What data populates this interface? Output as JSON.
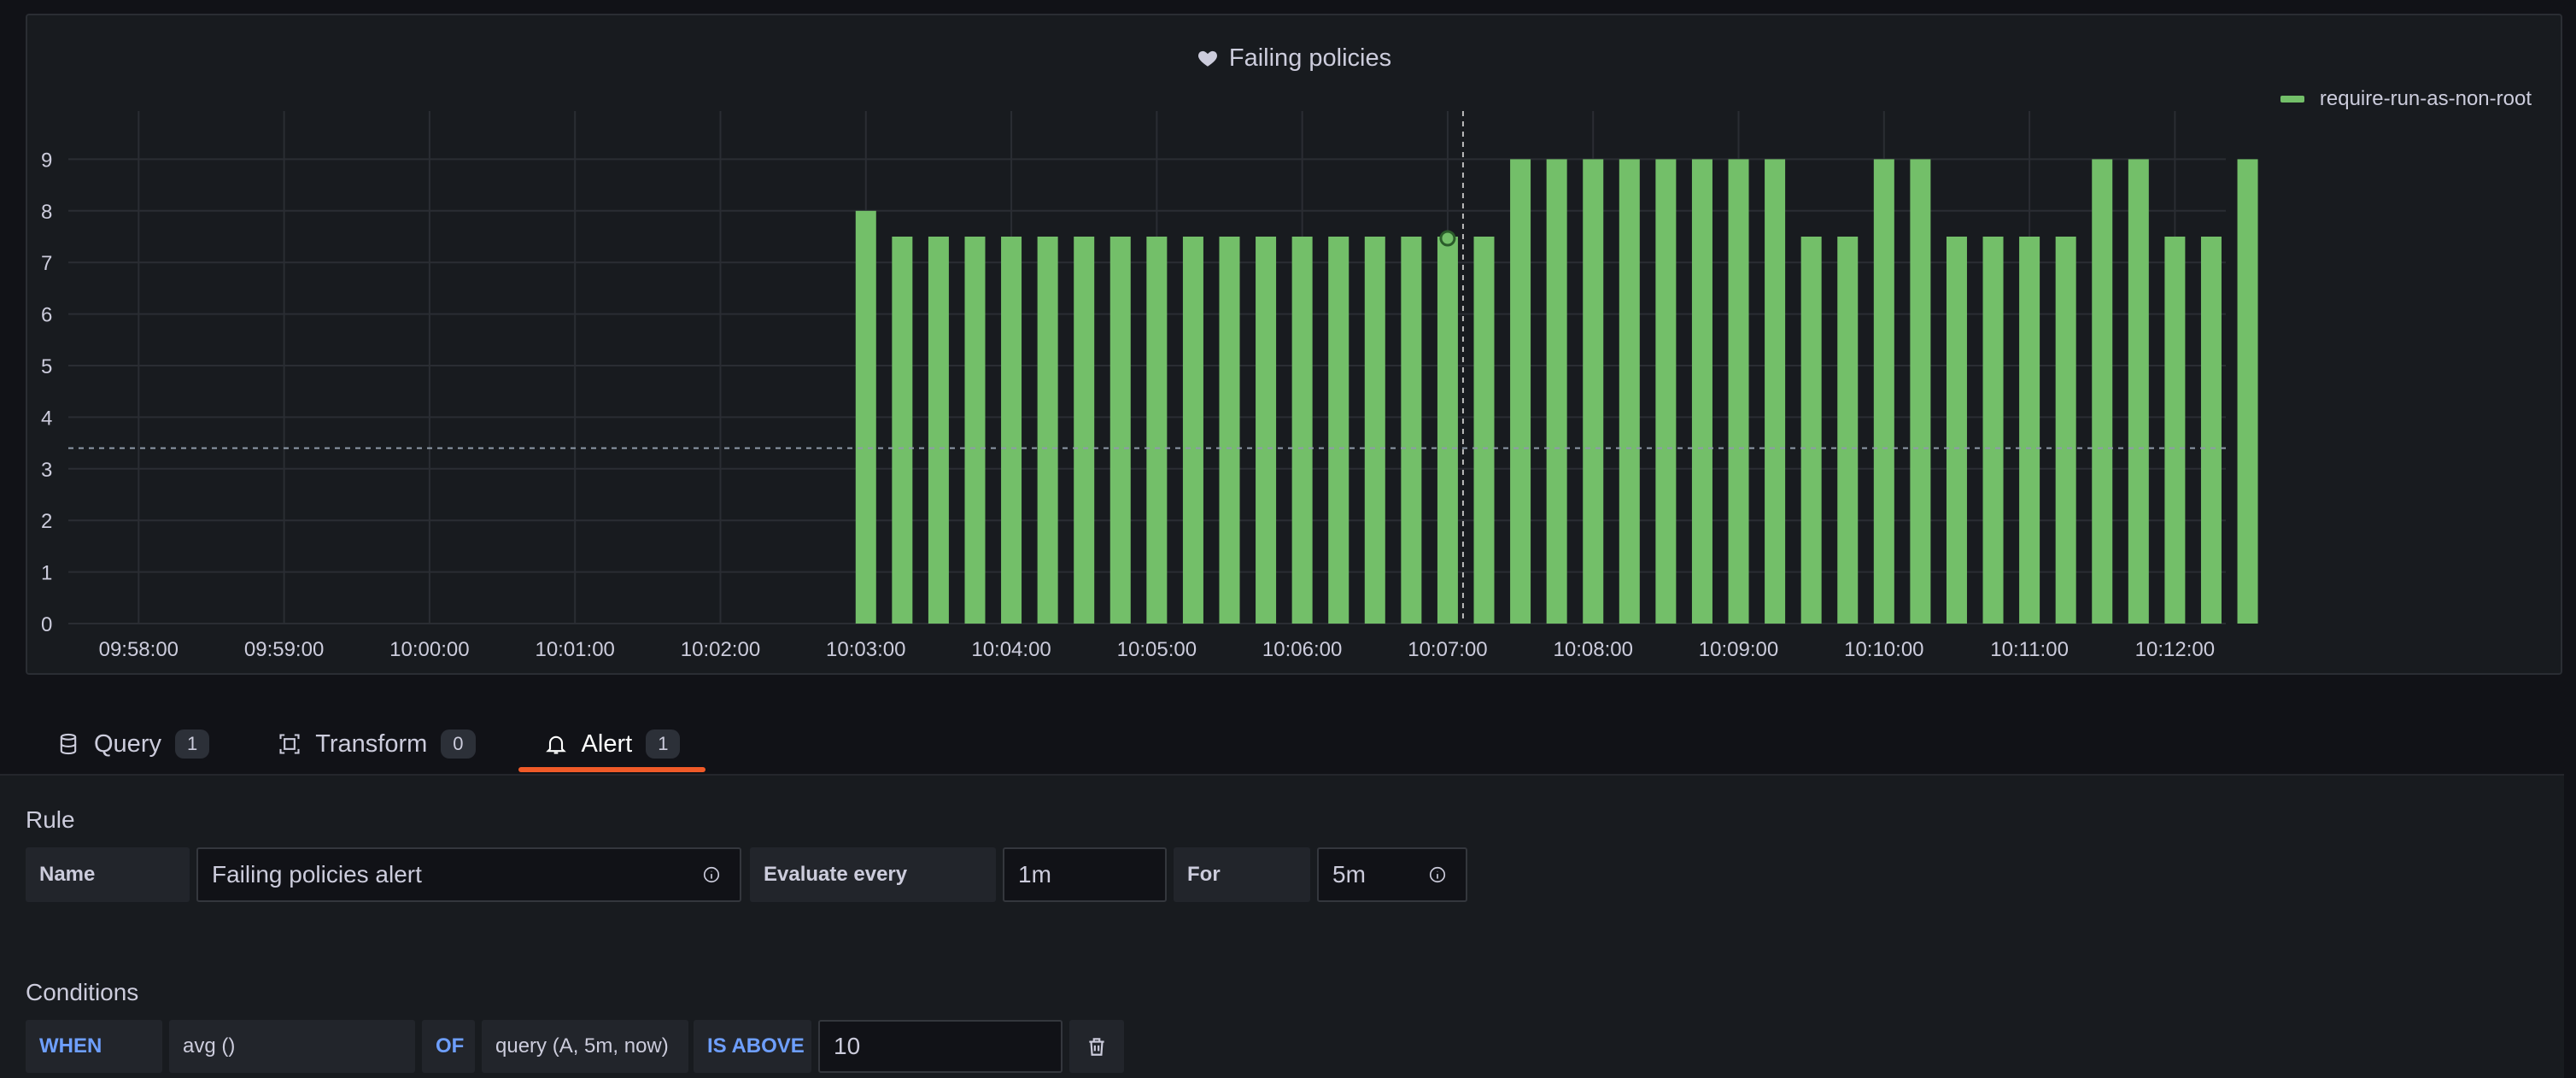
{
  "panel": {
    "title": "Failing policies",
    "title_icon": "heart-icon",
    "legend": [
      {
        "name": "require-run-as-non-root",
        "color": "#73bf69"
      }
    ]
  },
  "chart_data": {
    "type": "bar",
    "title": "Failing policies",
    "ylim": [
      0,
      10
    ],
    "y_ticks": [
      "0",
      "1",
      "2",
      "3",
      "4",
      "5",
      "6",
      "7",
      "8",
      "9"
    ],
    "x_ticks": [
      "09:58:00",
      "09:59:00",
      "10:00:00",
      "10:01:00",
      "10:02:00",
      "10:03:00",
      "10:04:00",
      "10:05:00",
      "10:06:00",
      "10:07:00",
      "10:08:00",
      "10:09:00",
      "10:10:00",
      "10:11:00",
      "10:12:00"
    ],
    "x_tick_seconds": [
      0,
      60,
      120,
      180,
      240,
      300,
      360,
      420,
      480,
      540,
      600,
      660,
      720,
      780,
      840
    ],
    "x_range_seconds": [
      -29,
      861
    ],
    "bar_start_seconds": 300,
    "bar_step_seconds": 15,
    "alert_threshold_line": 3.4,
    "hover_index": 16,
    "series": [
      {
        "name": "require-run-as-non-root",
        "color": "#73bf69",
        "values": [
          8,
          7.5,
          7.5,
          7.5,
          7.5,
          7.5,
          7.5,
          7.5,
          7.5,
          7.5,
          7.5,
          7.5,
          7.5,
          7.5,
          7.5,
          7.5,
          7.5,
          7.5,
          9,
          9,
          9,
          9,
          9,
          9,
          9,
          9,
          7.5,
          7.5,
          9,
          9,
          7.5,
          7.5,
          7.5,
          7.5,
          9,
          9,
          7.5,
          7.5,
          9
        ]
      }
    ],
    "grid": true
  },
  "tabs": [
    {
      "label": "Query",
      "count": "1",
      "icon": "database-icon",
      "active": false
    },
    {
      "label": "Transform",
      "count": "0",
      "icon": "transform-icon",
      "active": false
    },
    {
      "label": "Alert",
      "count": "1",
      "icon": "bell-icon",
      "active": true
    }
  ],
  "rule": {
    "section_title": "Rule",
    "name_label": "Name",
    "name_value": "Failing policies alert",
    "evaluate_label": "Evaluate every",
    "evaluate_value": "1m",
    "for_label": "For",
    "for_value": "5m"
  },
  "conditions": {
    "section_title": "Conditions",
    "when": "WHEN",
    "reducer": "avg ()",
    "of": "OF",
    "query": "query (A, 5m, now)",
    "evaluator": "IS ABOVE",
    "threshold": "10"
  },
  "colors": {
    "accent": "#f05a28",
    "series": "#73bf69",
    "keyword": "#6e9fff"
  }
}
